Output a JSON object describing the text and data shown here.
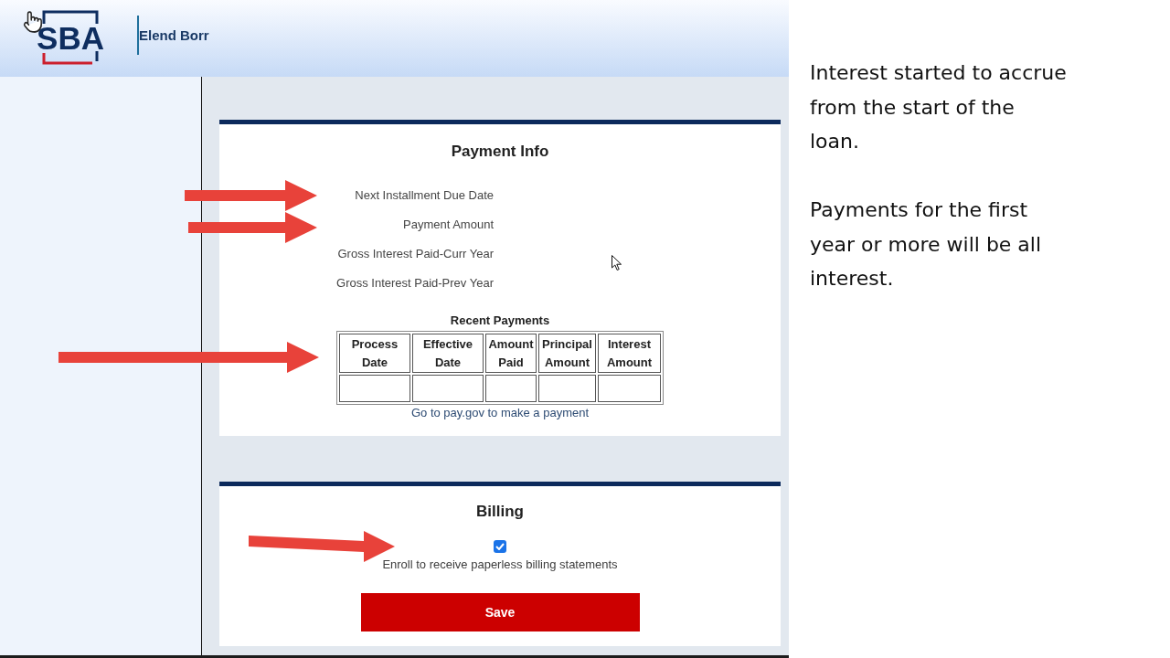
{
  "header": {
    "logo": "SBA",
    "app_title": "Elend Borr"
  },
  "payment_info": {
    "title": "Payment Info",
    "fields": [
      "Next Installment Due Date",
      "Payment Amount",
      "Gross Interest Paid-Curr Year",
      "Gross Interest Paid-Prev Year"
    ],
    "recent_payments": {
      "title": "Recent Payments",
      "columns": [
        "Process Date",
        "Effective Date",
        "Amount Paid",
        "Principal Amount",
        "Interest Amount"
      ]
    },
    "link": "Go to pay.gov to make a payment"
  },
  "billing": {
    "title": "Billing",
    "paperless": {
      "label": "Enroll to receive paperless billing statements",
      "checked": true
    },
    "save_button": "Save"
  },
  "notes": {
    "paragraphs": [
      {
        "lines": [
          "Interest started to accrue",
          "from the start of the",
          "loan."
        ]
      },
      {
        "lines": [
          "Payments for the first",
          "year or more will be all",
          "interest."
        ]
      }
    ]
  }
}
